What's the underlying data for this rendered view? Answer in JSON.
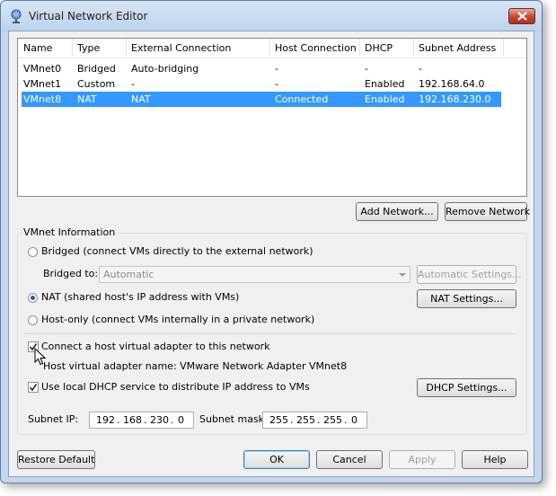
{
  "window": {
    "title": "Virtual Network Editor"
  },
  "list": {
    "columns": [
      "Name",
      "Type",
      "External Connection",
      "Host Connection",
      "DHCP",
      "Subnet Address"
    ],
    "rows": [
      [
        "VMnet0",
        "Bridged",
        "Auto-bridging",
        "-",
        "-",
        "-"
      ],
      [
        "VMnet1",
        "Custom",
        "-",
        "-",
        "Enabled",
        "192.168.64.0"
      ],
      [
        "VMnet8",
        "NAT",
        "NAT",
        "Connected",
        "Enabled",
        "192.168.230.0"
      ]
    ],
    "selected_row": 2
  },
  "buttons": {
    "add_network": "Add Network...",
    "remove_network": "Remove Network",
    "automatic_settings": "Automatic Settings...",
    "nat_settings": "NAT Settings...",
    "dhcp_settings": "DHCP Settings...",
    "restore_default": "Restore Default",
    "ok": "OK",
    "cancel": "Cancel",
    "apply": "Apply",
    "help": "Help"
  },
  "info": {
    "group_title": "VMnet Information",
    "bridged_label": "Bridged (connect VMs directly to the external network)",
    "bridged_to_label": "Bridged to:",
    "bridged_to_value": "Automatic",
    "nat_label": "NAT (shared host's IP address with VMs)",
    "hostonly_label": "Host-only (connect VMs internally in a private network)",
    "selected_mode": "nat",
    "connect_adapter_label": "Connect a host virtual adapter to this network",
    "connect_adapter_checked": true,
    "adapter_name_text": "Host virtual adapter name: VMware Network Adapter VMnet8",
    "dhcp_label": "Use local DHCP service to distribute IP address to VMs",
    "dhcp_checked": true,
    "subnet_ip_label": "Subnet IP:",
    "subnet_ip": [
      "192",
      "168",
      "230",
      "0"
    ],
    "subnet_mask_label": "Subnet mask:",
    "subnet_mask": [
      "255",
      "255",
      "255",
      "0"
    ]
  },
  "colors": {
    "selection": "#3399ff",
    "close_button": "#c7442f"
  },
  "icons": {
    "app": "network-globe-icon",
    "close": "close-icon",
    "check": "checkmark-icon",
    "pointer": "mouse-cursor-icon"
  }
}
